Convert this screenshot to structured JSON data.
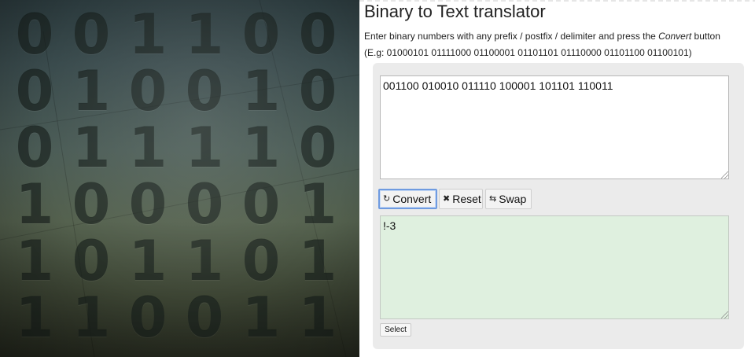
{
  "hero": {
    "rows": [
      [
        "0",
        "0",
        "1",
        "1",
        "0",
        "0"
      ],
      [
        "0",
        "1",
        "0",
        "0",
        "1",
        "0"
      ],
      [
        "0",
        "1",
        "1",
        "1",
        "1",
        "0"
      ],
      [
        "1",
        "0",
        "0",
        "0",
        "0",
        "1"
      ],
      [
        "1",
        "0",
        "1",
        "1",
        "0",
        "1"
      ],
      [
        "1",
        "1",
        "0",
        "0",
        "1",
        "1"
      ]
    ]
  },
  "page": {
    "title": "Binary to Text translator",
    "instruction_prefix": "Enter binary numbers with any prefix / postfix / delimiter and press the ",
    "instruction_em": "Convert",
    "instruction_suffix": " button",
    "example": "(E.g: 01000101 01111000 01100001 01101101 01110000 01101100 01100101)"
  },
  "input": {
    "value": "001100 010010 011110 100001 101101 110011"
  },
  "buttons": {
    "convert": {
      "label": "Convert",
      "icon": "refresh-icon"
    },
    "reset": {
      "label": "Reset",
      "icon": "close-icon"
    },
    "swap": {
      "label": "Swap",
      "icon": "swap-icon"
    },
    "select": {
      "label": "Select"
    }
  },
  "output": {
    "value": "!-3"
  },
  "colors": {
    "output_bg": "#dff0df",
    "focus_border": "#6f9be0",
    "panel_bg": "#ebebeb"
  }
}
